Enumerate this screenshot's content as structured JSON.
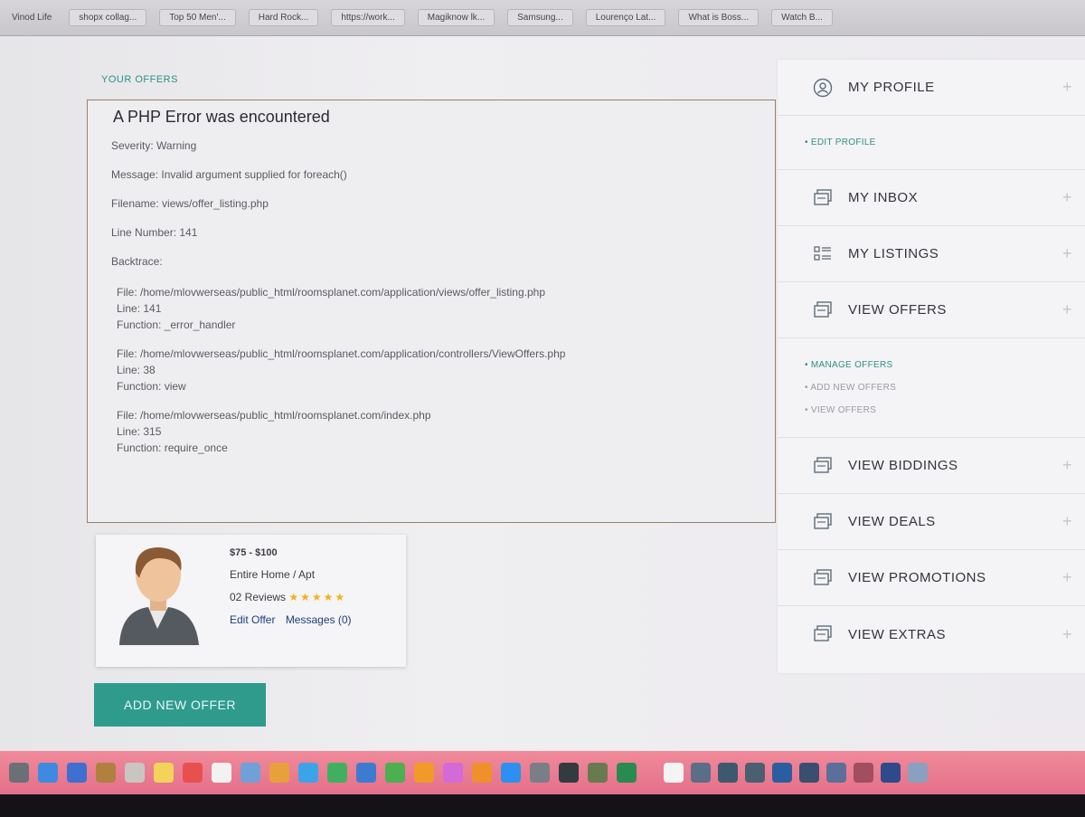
{
  "bookmarks": [
    "Vinod Life",
    "shopx collag...",
    "Top 50 Men'...",
    "Hard Rock...",
    "https://work...",
    "Magiknow lk...",
    "Samsung...",
    "Lourenço Lat...",
    "What is Boss...",
    "Watch B..."
  ],
  "section_title": "YOUR OFFERS",
  "error": {
    "heading": "A PHP Error was encountered",
    "severity": "Severity: Warning",
    "message": "Message: Invalid argument supplied for foreach()",
    "filename": "Filename: views/offer_listing.php",
    "line_number": "Line Number: 141",
    "backtrace_label": "Backtrace:",
    "traces": [
      {
        "file": "File: /home/mlovwerseas/public_html/roomsplanet.com/application/views/offer_listing.php",
        "line": "Line: 141",
        "function": "Function: _error_handler"
      },
      {
        "file": "File: /home/mlovwerseas/public_html/roomsplanet.com/application/controllers/ViewOffers.php",
        "line": "Line: 38",
        "function": "Function: view"
      },
      {
        "file": "File: /home/mlovwerseas/public_html/roomsplanet.com/index.php",
        "line": "Line: 315",
        "function": "Function: require_once"
      }
    ]
  },
  "offer": {
    "price": "$75 - $100",
    "type": "Entire Home / Apt",
    "reviews": "02 Reviews",
    "stars": "★★★★★",
    "edit_label": "Edit Offer",
    "messages_label": "Messages (0)"
  },
  "add_offer_button": "ADD NEW OFFER",
  "sidebar": {
    "profile": "MY PROFILE",
    "edit_profile": "EDIT PROFILE",
    "inbox": "MY INBOX",
    "listings": "MY LISTINGS",
    "view_offers": "VIEW OFFERS",
    "offer_sub": [
      "MANAGE OFFERS",
      "ADD NEW OFFERS",
      "VIEW OFFERS"
    ],
    "biddings": "VIEW BIDDINGS",
    "deals": "VIEW DEALS",
    "promotions": "VIEW PROMOTIONS",
    "extras": "VIEW EXTRAS",
    "plus": "+"
  },
  "colors": {
    "accent": "#2e9b8d",
    "dock": "#e4708a"
  },
  "dock_icons": [
    "finder-icon",
    "safari-icon",
    "mail-icon",
    "notes-icon",
    "contacts-icon",
    "stickies-icon",
    "calendar-icon",
    "reminders-icon",
    "preview-icon",
    "photos-icon",
    "messages-icon",
    "facetime-icon",
    "keynote-icon",
    "numbers-icon",
    "pages-icon",
    "itunes-icon",
    "ibooks-icon",
    "appstore-icon",
    "system-prefs-icon",
    "terminal-icon",
    "chess-icon",
    "money-icon",
    "doc-icon",
    "file-icon-1",
    "file-icon-2",
    "file-icon-3",
    "file-icon-4",
    "file-icon-5",
    "file-icon-6",
    "file-icon-7",
    "file-icon-8",
    "file-icon-9"
  ]
}
